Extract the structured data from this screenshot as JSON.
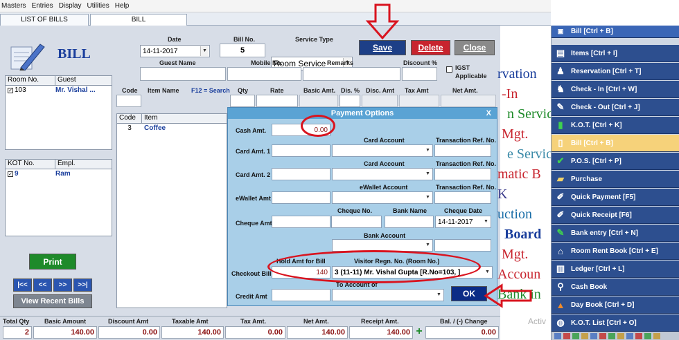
{
  "menu": [
    "Masters",
    "Entries",
    "Display",
    "Utilities",
    "Help"
  ],
  "tabs": [
    "LIST OF BILLS",
    "BILL"
  ],
  "title": "BILL",
  "header": {
    "date_label": "Date",
    "date_value": "14-11-2017",
    "billno_label": "Bill No.",
    "billno_value": "5",
    "service_label": "Service Type",
    "service_value": "Room Service",
    "save": "Save",
    "delete": "Delete",
    "close": "Close",
    "guest_name_label": "Guest Name",
    "mobile_label": "Mobile No.",
    "remarks_label": "Remarks",
    "discount_label": "Discount %",
    "igst_label": "IGST",
    "igst_label2": "Applicable"
  },
  "items_header": [
    "Code",
    "Item Name",
    "F12 = Search",
    "Qty",
    "Rate",
    "Basic Amt.",
    "Dis. %",
    "Disc. Amt",
    "Tax Amt",
    "Net Amt."
  ],
  "room_panel": {
    "cols": [
      "Room No.",
      "Guest"
    ],
    "rows": [
      [
        "103",
        "Mr. Vishal ..."
      ]
    ]
  },
  "kot_panel": {
    "cols": [
      "KOT No.",
      "Empl."
    ],
    "rows": [
      [
        "9",
        "Ram"
      ]
    ]
  },
  "item_list": {
    "cols": [
      "Code",
      "Item"
    ],
    "rows": [
      [
        "3",
        "Coffee"
      ]
    ]
  },
  "print": "Print",
  "nav": [
    "|<<",
    "<<",
    ">>",
    ">>|"
  ],
  "view_recent": "View Recent Bills",
  "payment": {
    "title": "Payment Options",
    "close_x": "X",
    "cash_label": "Cash Amt.",
    "cash_value": "0.00",
    "card1_label": "Card Amt. 1",
    "card2_label": "Card Amt. 2",
    "card_account": "Card Account",
    "txn_ref": "Transaction Ref. No.",
    "ewallet_label": "eWallet Amt",
    "ewallet_account": "eWallet Account",
    "cheque_label": "Cheque Amt",
    "cheque_no": "Cheque No.",
    "bank_name": "Bank Name",
    "cheque_date": "Cheque Date",
    "cheque_date_value": "14-11-2017",
    "bank_account": "Bank Account",
    "checkout_label": "Checkout Bill",
    "hold_label": "Hold Amt for Bill",
    "hold_value": "140",
    "visitor_label": "Visitor Regn. No. (Room No.)",
    "visitor_value": "3 (11-11) Mr. Vishal Gupta [R.No=103, ]",
    "credit_label": "Credit Amt",
    "to_account": "To Account of",
    "ok": "OK"
  },
  "totals": {
    "total_qty_label": "Total Qty",
    "total_qty": "2",
    "basic_label": "Basic Amount",
    "basic": "140.00",
    "discount_label": "Discount Amt",
    "discount": "0.00",
    "taxable_label": "Taxable Amt",
    "taxable": "140.00",
    "tax_label": "Tax Amt.",
    "tax": "0.00",
    "net_label": "Net Amt.",
    "net": "140.00",
    "receipt_label": "Receipt Amt.",
    "receipt": "140.00",
    "bal_label": "Bal. / (-) Change",
    "bal": "0.00"
  },
  "sidebar": {
    "top": "Bill [Ctrl + B]",
    "items": [
      "Items [Ctrl + I]",
      "Reservation [Ctrl + T]",
      "Check - In [Ctrl + W]",
      "Check - Out [Ctrl + J]",
      "K.O.T. [Ctrl + K]",
      "Bill [Ctrl + B]",
      "P.O.S. [Ctrl + P]",
      "Purchase",
      "Quick Payment [F5]",
      "Quick Receipt [F6]",
      "Bank entry [Ctrl + N]",
      "Room Rent Book [Ctrl + E]",
      "Ledger [Ctrl + L]",
      "Cash Book",
      "Day Book [Ctrl + D]",
      "K.O.T. List [Ctrl + O]"
    ]
  },
  "bg_words": [
    "rvation",
    "-In",
    "n Servic",
    "Mgt.",
    "e Servic",
    "matic B",
    "K",
    "uction",
    "Board",
    "Mgt.",
    "Accoun",
    "Bank in"
  ],
  "watermark": "Activ",
  "colors": {
    "save": "#1d3f87",
    "delete": "#c8242e",
    "close": "#8a8a8a",
    "print": "#1e8a2a",
    "ok": "#0b2c86",
    "annotation": "#d9141f"
  }
}
